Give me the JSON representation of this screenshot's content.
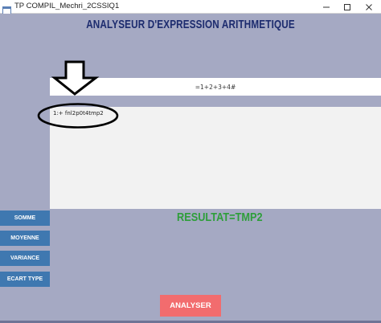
{
  "window": {
    "title": "TP COMPIL_Mechri_2CSSIQ1",
    "icons": [
      "app-icon",
      "minimize-icon",
      "maximize-icon",
      "close-icon"
    ]
  },
  "header": {
    "title": "ANALYSEUR D'EXPRESSION ARITHMETIQUE"
  },
  "expression": {
    "value": "=1+2+3+4#"
  },
  "output": {
    "text": "1:+ fnl2p0t4tmp2"
  },
  "annotations": {
    "icons": [
      "down-arrow-icon",
      "highlight-ellipse"
    ]
  },
  "result": {
    "text": "RESULTAT=TMP2"
  },
  "sidebar": {
    "buttons": [
      {
        "label": "SOMME"
      },
      {
        "label": "MOYENNE"
      },
      {
        "label": "VARIANCE"
      },
      {
        "label": "ECART TYPE"
      }
    ]
  },
  "actions": {
    "analyser_label": "ANALYSER"
  },
  "colors": {
    "background": "#a5a9c3",
    "heading": "#1c2b6e",
    "result": "#2e9e3a",
    "side_button": "#3f78b0",
    "analyser_button": "#f26c6e"
  }
}
